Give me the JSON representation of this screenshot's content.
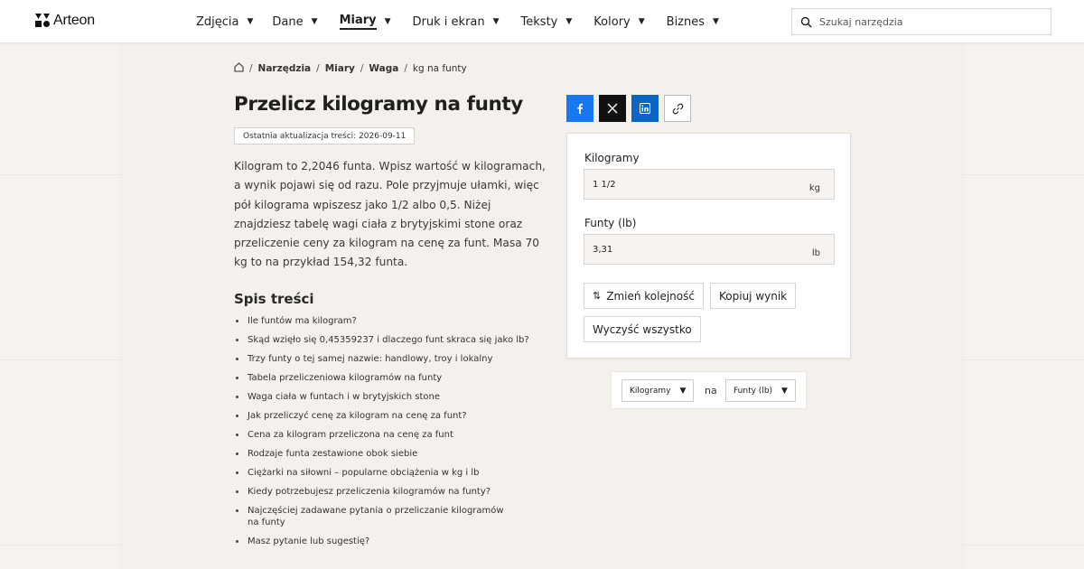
{
  "header": {
    "logo_text": "Arteon",
    "nav": [
      {
        "label": "Zdjęcia",
        "active": false
      },
      {
        "label": "Dane",
        "active": false
      },
      {
        "label": "Miary",
        "active": true
      },
      {
        "label": "Druk i ekran",
        "active": false
      },
      {
        "label": "Teksty",
        "active": false
      },
      {
        "label": "Kolory",
        "active": false
      },
      {
        "label": "Biznes",
        "active": false
      }
    ],
    "search_placeholder": "Szukaj narzędzia"
  },
  "breadcrumb": {
    "items": [
      "Narzędzia",
      "Miary",
      "Waga"
    ],
    "current": "kg na funty"
  },
  "page": {
    "title": "Przelicz kilogramy na funty",
    "updated": "Ostatnia aktualizacja treści: 2026-09-11",
    "intro": "Kilogram to 2,2046 funta. Wpisz wartość w kilogramach, a wynik pojawi się od razu. Pole przyjmuje ułamki, więc pół kilograma wpiszesz jako 1/2 albo 0,5. Niżej znajdziesz tabelę wagi ciała z brytyjskimi stone oraz przeliczenie ceny za kilogram na cenę za funt. Masa 70 kg to na przykład 154,32 funta."
  },
  "toc": {
    "title": "Spis treści",
    "items": [
      "Ile funtów ma kilogram?",
      "Skąd wzięło się 0,45359237 i dlaczego funt skraca się jako lb?",
      "Trzy funty o tej samej nazwie: handlowy, troy i lokalny",
      "Tabela przeliczeniowa kilogramów na funty",
      "Waga ciała w funtach i w brytyjskich stone",
      "Jak przeliczyć cenę za kilogram na cenę za funt?",
      "Cena za kilogram przeliczona na cenę za funt",
      "Rodzaje funta zestawione obok siebie",
      "Ciężarki na siłowni – popularne obciążenia w kg i lb",
      "Kiedy potrzebujesz przeliczenia kilogramów na funty?",
      "Najczęściej zadawane pytania o przeliczanie kilogramów na funty",
      "Masz pytanie lub sugestię?"
    ]
  },
  "share": {
    "icons": [
      "facebook-icon",
      "x-icon",
      "linkedin-icon",
      "link-icon"
    ],
    "colors": {
      "facebook": "#1877f2",
      "x": "#111111",
      "linkedin": "#0a66c2"
    }
  },
  "converter": {
    "from_label": "Kilogramy",
    "from_value": "1 1/2",
    "from_unit": "kg",
    "to_label": "Funty (lb)",
    "to_value": "3,31",
    "to_unit": "lb",
    "swap_label": "Zmień kolejność",
    "copy_label": "Kopiuj wynik",
    "clear_label": "Wyczyść wszystko"
  },
  "selectors": {
    "from": "Kilogramy",
    "connector": "na",
    "to": "Funty (lb)"
  }
}
